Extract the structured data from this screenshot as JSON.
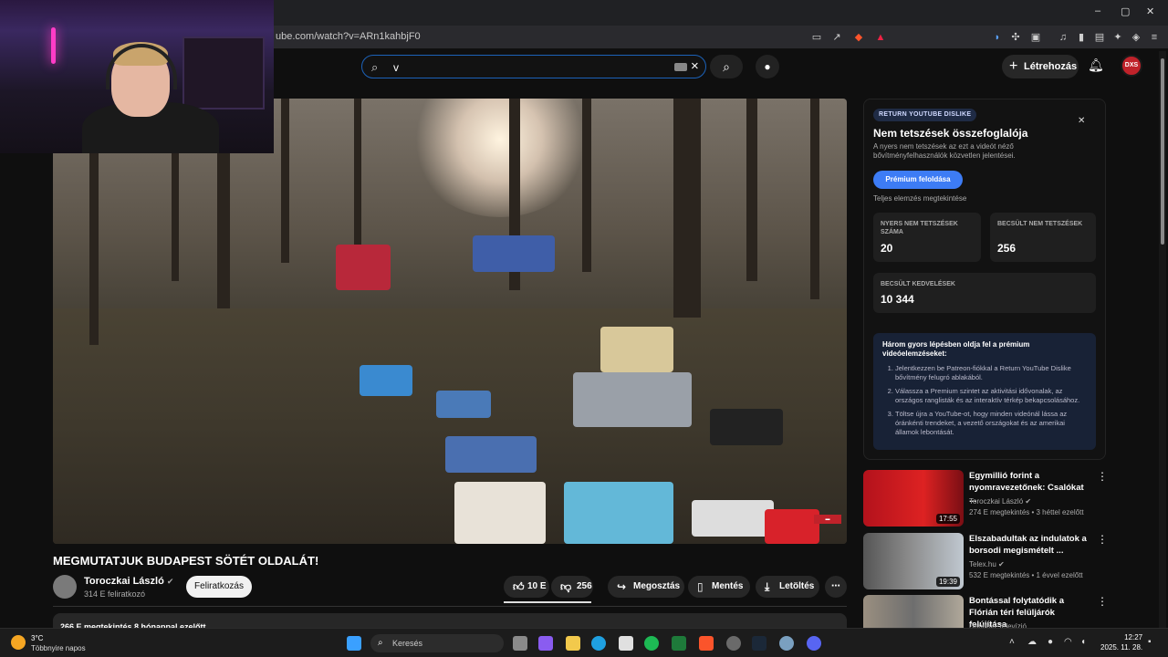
{
  "browser": {
    "url": "ube.com/watch?v=ARn1kahbjF0",
    "window_controls": {
      "minimize": "–",
      "restore": "▢",
      "close": "✕"
    }
  },
  "header": {
    "search_value": "v",
    "create_label": "Létrehozás",
    "avatar_text": "DXS"
  },
  "video": {
    "title": "MEGMUTATJUK BUDAPEST SÖTÉT OLDALÁT!",
    "channel": "Toroczkai László",
    "subscribers": "314 E feliratkozó",
    "subscribe_label": "Feliratkozás",
    "likes": "10 E",
    "dislikes": "256",
    "share_label": "Megosztás",
    "save_label": "Mentés",
    "download_label": "Letöltés",
    "description_meta": "266 E megtekintés  8 hónappal ezelőtt",
    "like_fraction": 1.0
  },
  "dislike_panel": {
    "badge": "RETURN YOUTUBE DISLIKE",
    "title": "Nem tetszések összefoglalója",
    "subtitle": "A nyers nem tetszések az ezt a videót néző bővítményfelhasználók közvetlen jelentései.",
    "premium_button": "Prémium feloldása",
    "full_analysis": "Teljes elemzés megtekintése",
    "stats": [
      {
        "label": "NYERS NEM TETSZÉSEK SZÁMA",
        "value": "20"
      },
      {
        "label": "BECSÜLT NEM TETSZÉSEK",
        "value": "256"
      },
      {
        "label": "BECSÜLT KEDVELÉSEK",
        "value": "10 344"
      }
    ],
    "promo_heading": "Három gyors lépésben oldja fel a prémium videóelemzéseket:",
    "promo_steps": [
      "Jelentkezzen be Patreon-fiókkal a Return YouTube Dislike bővítmény felugró ablakából.",
      "Válassza a Premium szintet az aktivitási idővonalak, az országos ranglisták és az interaktív térkép bekapcsolásához.",
      "Töltse újra a YouTube-ot, hogy minden videónál lássa az óránkénti trendeket, a vezető országokat és az amerikai államok lebontását."
    ]
  },
  "recommendations": [
    {
      "title": "Egymillió forint a nyomravezetőnek: Csalókat ...",
      "channel": "Toroczkai László",
      "meta": "274 E megtekintés • 3 héttel ezelőtt",
      "duration": "17:55",
      "verified": true
    },
    {
      "title": "Elszabadultak az indulatok a borsodi megismételt ...",
      "channel": "Telex.hu",
      "meta": "532 E megtekintés • 1 évvel ezelőtt",
      "duration": "19:39",
      "verified": true
    },
    {
      "title": "Bontással folytatódik a Flórián téri felüljárók felújítása",
      "channel": "Danubia Televízió",
      "meta": "",
      "duration": "",
      "verified": false
    }
  ],
  "taskbar": {
    "temperature": "3°C",
    "weather": "Többnyire napos",
    "search_label": "Keresés",
    "time": "12:27",
    "date": "2025. 11. 28."
  },
  "colors": {
    "accent": "#3d7cf5",
    "brand_red": "#c0222a"
  }
}
